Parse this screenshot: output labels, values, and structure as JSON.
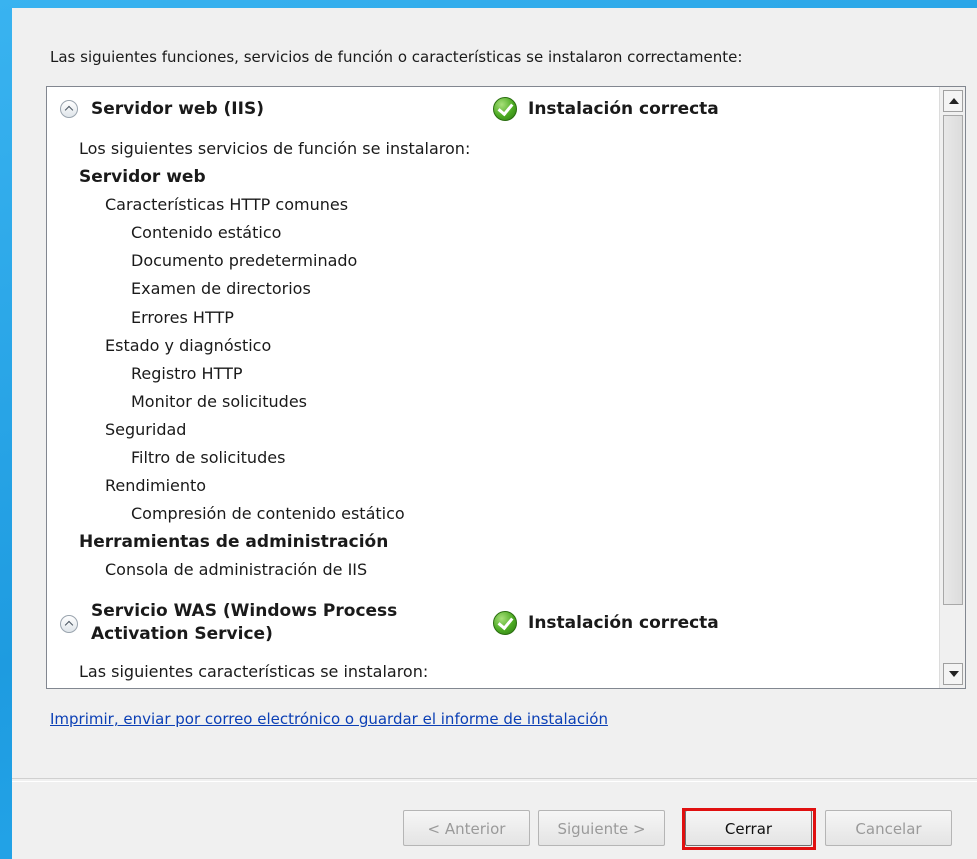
{
  "dialog": {
    "header": "Las siguientes funciones, servicios de función o características se instalaron correctamente:"
  },
  "sections": [
    {
      "title": "Servidor web (IIS)",
      "status": "Instalación correcta",
      "intro": "Los siguientes servicios de función se instalaron:",
      "items": [
        {
          "text": "Servidor web",
          "level": 0,
          "bold": true
        },
        {
          "text": "Características HTTP comunes",
          "level": 1
        },
        {
          "text": "Contenido estático",
          "level": 2
        },
        {
          "text": "Documento predeterminado",
          "level": 2
        },
        {
          "text": "Examen de directorios",
          "level": 2
        },
        {
          "text": "Errores HTTP",
          "level": 2
        },
        {
          "text": "Estado y diagnóstico",
          "level": 1
        },
        {
          "text": "Registro HTTP",
          "level": 2
        },
        {
          "text": "Monitor de solicitudes",
          "level": 2
        },
        {
          "text": "Seguridad",
          "level": 1
        },
        {
          "text": "Filtro de solicitudes",
          "level": 2
        },
        {
          "text": "Rendimiento",
          "level": 1
        },
        {
          "text": "Compresión de contenido estático",
          "level": 2
        },
        {
          "text": "Herramientas de administración",
          "level": 0,
          "bold": true
        },
        {
          "text": "Consola de administración de IIS",
          "level": 1
        }
      ]
    },
    {
      "title_line1": "Servicio WAS (Windows Process",
      "title_line2": "Activation Service)",
      "status": "Instalación correcta",
      "intro": "Las siguientes características se instalaron:"
    }
  ],
  "report_link": "Imprimir, enviar por correo electrónico o guardar el informe de instalación",
  "buttons": {
    "back": "< Anterior",
    "next": "Siguiente >",
    "close": "Cerrar",
    "cancel": "Cancelar"
  },
  "colors": {
    "highlight": "#e01010",
    "link": "#0b3fb5"
  }
}
